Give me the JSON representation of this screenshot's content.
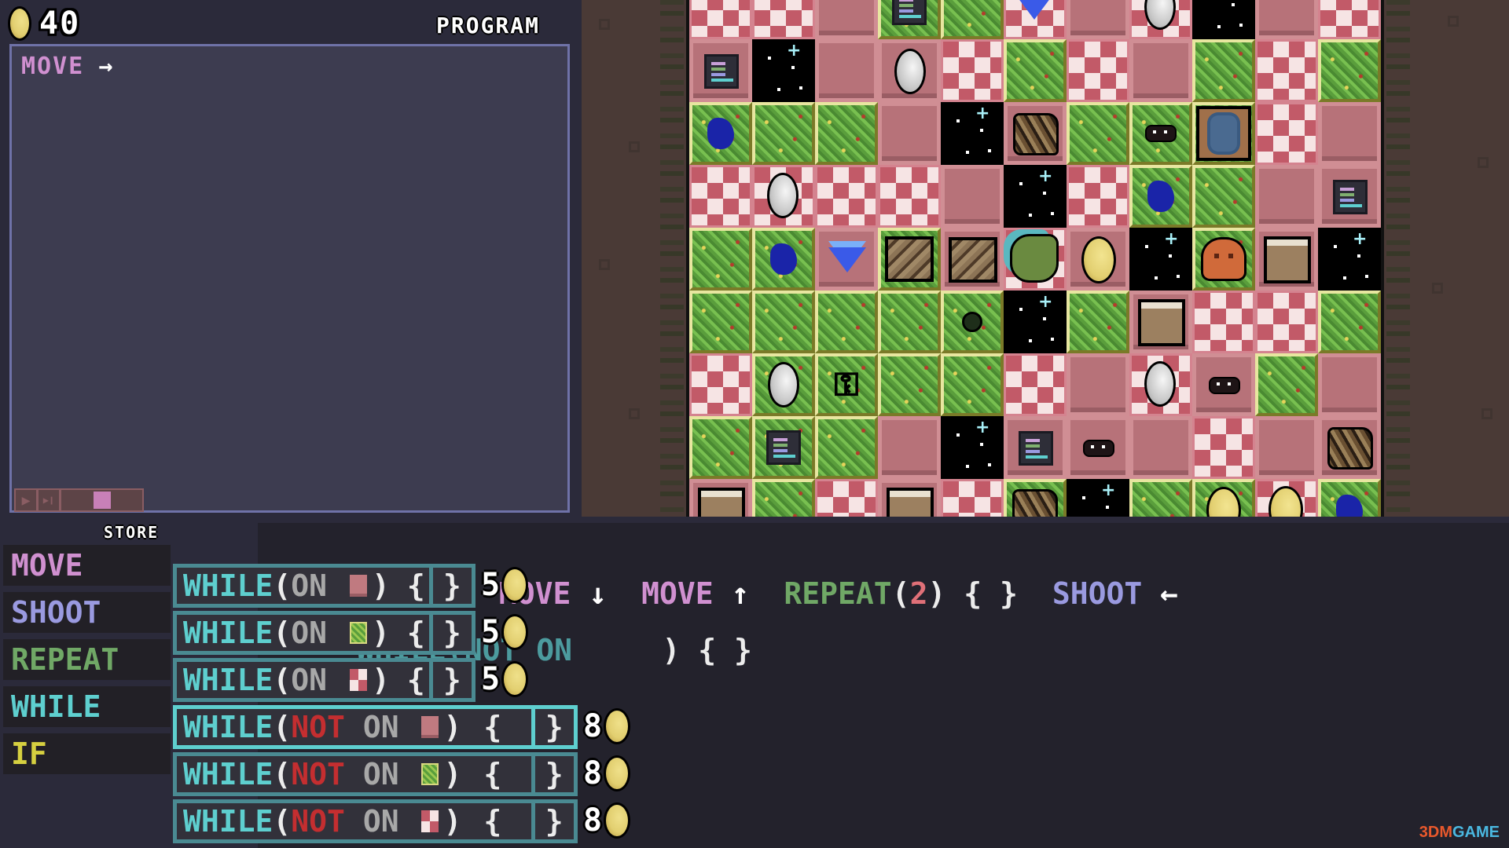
{
  "header": {
    "coins": "40",
    "coin_icon": "gold-coin-icon",
    "program_title": "PROGRAM"
  },
  "program": {
    "lines": [
      {
        "keyword": "MOVE",
        "arrow": "→",
        "direction": "right"
      }
    ],
    "playback": {
      "play_icon": "▶",
      "step_icon": "▶❙",
      "speed_fraction": 0.5
    }
  },
  "store": {
    "title": "STORE",
    "categories": [
      {
        "label": "MOVE",
        "kind": "move"
      },
      {
        "label": "SHOOT",
        "kind": "shoot"
      },
      {
        "label": "REPEAT",
        "kind": "repeat"
      },
      {
        "label": "WHILE",
        "kind": "while"
      },
      {
        "label": "IF",
        "kind": "if"
      }
    ],
    "items_row1": [
      {
        "keyword": "MOVE",
        "arrow": "↓"
      },
      {
        "keyword": "MOVE",
        "arrow": "↓"
      },
      {
        "keyword": "MOVE",
        "arrow": "↑"
      },
      {
        "keyword": "REPEAT",
        "open": "(",
        "count": "2",
        "close": ")",
        "braces": "{ }"
      },
      {
        "keyword": "SHOOT",
        "arrow": "←"
      }
    ],
    "items_row2_partial": {
      "text": "WHILE(NOT ON",
      "close": ")",
      "braces": "{ }"
    }
  },
  "popup": {
    "rows": [
      {
        "keyword": "WHILE",
        "open": "(",
        "not": "",
        "on": "ON",
        "tile": "stone",
        "close": ")",
        "brace_open": "{",
        "brace_close": "}",
        "price": "5",
        "highlight": false
      },
      {
        "keyword": "WHILE",
        "open": "(",
        "not": "",
        "on": "ON",
        "tile": "grass",
        "close": ")",
        "brace_open": "{",
        "brace_close": "}",
        "price": "5",
        "highlight": false
      },
      {
        "keyword": "WHILE",
        "open": "(",
        "not": "",
        "on": "ON",
        "tile": "checker",
        "close": ")",
        "brace_open": "{",
        "brace_close": "}",
        "price": "5",
        "highlight": false
      },
      {
        "keyword": "WHILE",
        "open": "(",
        "not": "NOT",
        "on": "ON",
        "tile": "stone",
        "close": ")",
        "brace_open": "{",
        "brace_close": "}",
        "price": "8",
        "highlight": true
      },
      {
        "keyword": "WHILE",
        "open": "(",
        "not": "NOT",
        "on": "ON",
        "tile": "grass",
        "close": ")",
        "brace_open": "{",
        "brace_close": "}",
        "price": "8",
        "highlight": false
      },
      {
        "keyword": "WHILE",
        "open": "(",
        "not": "NOT",
        "on": "ON",
        "tile": "checker",
        "close": ")",
        "brace_open": "{",
        "brace_close": "}",
        "price": "8",
        "highlight": false
      }
    ]
  },
  "board": {
    "legend": {
      "C": "checker-tile",
      "S": "stone-tile",
      "G": "grass-tile",
      "V": "void-tile"
    },
    "rows": [
      [
        [
          "C",
          ""
        ],
        [
          "C",
          ""
        ],
        [
          "S",
          ""
        ],
        [
          "G",
          "terminal"
        ],
        [
          "G",
          ""
        ],
        [
          "C",
          "gem"
        ],
        [
          "S",
          ""
        ],
        [
          "C",
          "egg"
        ],
        [
          "V",
          ""
        ],
        [
          "S",
          ""
        ],
        [
          "C",
          ""
        ]
      ],
      [
        [
          "S",
          "terminal"
        ],
        [
          "V",
          ""
        ],
        [
          "S",
          ""
        ],
        [
          "S",
          "egg"
        ],
        [
          "C",
          ""
        ],
        [
          "G",
          ""
        ],
        [
          "C",
          ""
        ],
        [
          "S",
          ""
        ],
        [
          "G",
          ""
        ],
        [
          "C",
          ""
        ],
        [
          "G",
          ""
        ]
      ],
      [
        [
          "G",
          "slime"
        ],
        [
          "G",
          ""
        ],
        [
          "G",
          ""
        ],
        [
          "S",
          ""
        ],
        [
          "V",
          ""
        ],
        [
          "S",
          "rock"
        ],
        [
          "G",
          ""
        ],
        [
          "G",
          "eyes"
        ],
        [
          "G",
          "player"
        ],
        [
          "C",
          ""
        ],
        [
          "S",
          ""
        ]
      ],
      [
        [
          "C",
          ""
        ],
        [
          "C",
          "egg"
        ],
        [
          "C",
          ""
        ],
        [
          "C",
          ""
        ],
        [
          "S",
          ""
        ],
        [
          "V",
          ""
        ],
        [
          "C",
          ""
        ],
        [
          "G",
          "slime"
        ],
        [
          "G",
          ""
        ],
        [
          "S",
          ""
        ],
        [
          "S",
          "terminal"
        ]
      ],
      [
        [
          "G",
          ""
        ],
        [
          "G",
          "slime"
        ],
        [
          "S",
          "gem"
        ],
        [
          "G",
          "box"
        ],
        [
          "S",
          "box"
        ],
        [
          "C",
          "dragon"
        ],
        [
          "S",
          "coin"
        ],
        [
          "V",
          ""
        ],
        [
          "G",
          "monster"
        ],
        [
          "S",
          "tower"
        ],
        [
          "V",
          ""
        ]
      ],
      [
        [
          "G",
          ""
        ],
        [
          "G",
          ""
        ],
        [
          "G",
          ""
        ],
        [
          "G",
          ""
        ],
        [
          "G",
          "dark-eye"
        ],
        [
          "V",
          ""
        ],
        [
          "G",
          ""
        ],
        [
          "S",
          "tower"
        ],
        [
          "C",
          ""
        ],
        [
          "C",
          ""
        ],
        [
          "G",
          ""
        ]
      ],
      [
        [
          "C",
          ""
        ],
        [
          "G",
          "egg"
        ],
        [
          "G",
          "key"
        ],
        [
          "G",
          ""
        ],
        [
          "G",
          ""
        ],
        [
          "C",
          ""
        ],
        [
          "S",
          ""
        ],
        [
          "C",
          "egg"
        ],
        [
          "S",
          "eyes"
        ],
        [
          "G",
          ""
        ],
        [
          "S",
          ""
        ]
      ],
      [
        [
          "G",
          ""
        ],
        [
          "G",
          "terminal"
        ],
        [
          "G",
          ""
        ],
        [
          "S",
          ""
        ],
        [
          "V",
          ""
        ],
        [
          "S",
          "terminal"
        ],
        [
          "S",
          "eyes"
        ],
        [
          "S",
          ""
        ],
        [
          "C",
          ""
        ],
        [
          "S",
          ""
        ],
        [
          "S",
          "rock"
        ]
      ],
      [
        [
          "S",
          "tower"
        ],
        [
          "G",
          ""
        ],
        [
          "C",
          ""
        ],
        [
          "S",
          "tower"
        ],
        [
          "C",
          ""
        ],
        [
          "G",
          "rock"
        ],
        [
          "V",
          ""
        ],
        [
          "G",
          ""
        ],
        [
          "G",
          "coin"
        ],
        [
          "C",
          "coin"
        ],
        [
          "G",
          "slime"
        ]
      ]
    ]
  },
  "colors": {
    "move": "#d090d0",
    "shoot": "#9a9ae0",
    "repeat": "#70a866",
    "while": "#5ecfcf",
    "if": "#d6d040",
    "not": "#c42e30",
    "number": "#e07078"
  },
  "watermark": {
    "part1": "3DM",
    "part2": "GAME"
  }
}
